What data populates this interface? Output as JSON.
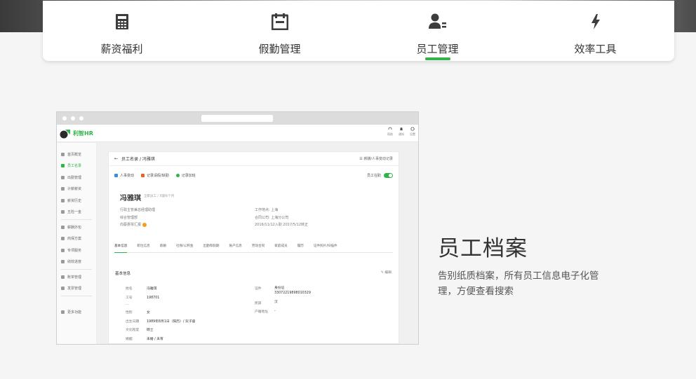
{
  "nav": {
    "items": [
      {
        "label": "薪资福利",
        "icon": "calculator-icon"
      },
      {
        "label": "假勤管理",
        "icon": "calendar-icon"
      },
      {
        "label": "员工管理",
        "icon": "employee-icon",
        "active": true
      },
      {
        "label": "效率工具",
        "icon": "lightning-icon"
      }
    ]
  },
  "mock": {
    "logo": "利智HR",
    "header_icons": [
      "帮助",
      "通知",
      "设置"
    ],
    "sidebar": [
      "首页概览",
      "员工名录",
      "出勤管理",
      "计薪薪资",
      "薪资历史",
      "五险一金",
      "薪酬外包",
      "商保方案",
      "专项服务",
      "绩效进度",
      "账单管理",
      "发票管理",
      "更多功能"
    ],
    "breadcrumb": "员工名录 / 冯雅琪",
    "record_link": "薪酬/人事变动记录",
    "actions": [
      "人事变动",
      "记录请假/缺勤",
      "记录加班"
    ],
    "status_label": "员工在职",
    "employee": {
      "name": "冯雅琪",
      "sub": "全职员工 / 司龄6个月",
      "left": [
        "行政主管兼总经理助理",
        "综合管理部",
        "向蔡惠琴汇报"
      ],
      "right": [
        "工作地点: 上海",
        "合同公司: 上海分公司",
        "2016/11/12入职 2017/5/12转正"
      ]
    },
    "tabs": [
      "基本信息",
      "职位信息",
      "薪酬",
      "社保/公积金",
      "出勤和假期",
      "账户信息",
      "劳动合同",
      "家庭成员",
      "履历",
      "证件照片/扫描件"
    ],
    "section_title": "基本信息",
    "edit_label": "编辑",
    "details_left": [
      {
        "k": "姓名",
        "v": "冯雅琪"
      },
      {
        "k": "工号",
        "v": "198701"
      },
      {
        "k": "…",
        "v": ""
      },
      {
        "k": "性别",
        "v": "女"
      },
      {
        "k": "出生日期",
        "v": "1989年8月1日（阳历）/ 双子座"
      },
      {
        "k": "文化程度",
        "v": "硕士"
      },
      {
        "k": "婚姻",
        "v": "未婚 / 未育"
      }
    ],
    "details_right": [
      {
        "k": "证件",
        "v": "身份证"
      },
      {
        "k": "",
        "v": "33072219898010329"
      },
      {
        "k": "民族",
        "v": "汉"
      },
      {
        "k": "户籍地址",
        "v": "-"
      }
    ]
  },
  "feature": {
    "title": "员工档案",
    "desc": "告别纸质档案，所有员工信息电子化管理，方便查看搜索"
  },
  "colors": {
    "accent": "#2fb34a"
  }
}
